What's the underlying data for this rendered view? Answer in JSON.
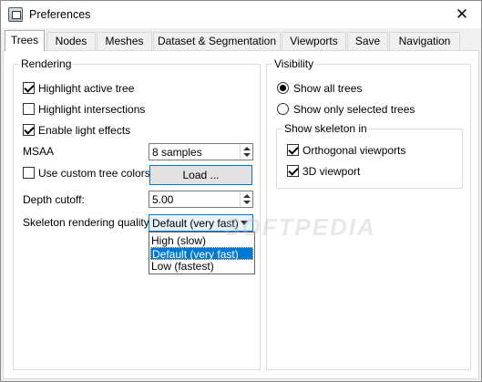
{
  "window": {
    "title": "Preferences",
    "close_glyph": "✕"
  },
  "tabs": [
    {
      "label": "Trees",
      "active": true
    },
    {
      "label": "Nodes"
    },
    {
      "label": "Meshes"
    },
    {
      "label": "Dataset & Segmentation"
    },
    {
      "label": "Viewports"
    },
    {
      "label": "Save"
    },
    {
      "label": "Navigation"
    }
  ],
  "rendering": {
    "title": "Rendering",
    "highlight_active_tree": {
      "label": "Highlight active tree",
      "checked": true
    },
    "highlight_intersections": {
      "label": "Highlight intersections",
      "checked": false
    },
    "enable_light_effects": {
      "label": "Enable light effects",
      "checked": true
    },
    "msaa": {
      "label": "MSAA",
      "value": "8 samples"
    },
    "custom_tree_colors": {
      "label": "Use custom tree colors",
      "checked": false
    },
    "load_button": "Load ...",
    "depth_cutoff": {
      "label": "Depth cutoff:",
      "value": "5.00"
    },
    "skeleton_quality": {
      "label": "Skeleton rendering quality:",
      "value": "Default (very fast)",
      "options": [
        "High (slow)",
        "Default (very fast)",
        "Low (fastest)"
      ],
      "selected_index": 1
    }
  },
  "visibility": {
    "title": "Visibility",
    "show_all_trees": {
      "label": "Show all trees",
      "checked": true
    },
    "show_selected_trees": {
      "label": "Show only selected trees",
      "checked": false
    },
    "show_skeleton_in": {
      "title": "Show skeleton in",
      "orthogonal": {
        "label": "Orthogonal viewports",
        "checked": true
      },
      "viewport_3d": {
        "label": "3D viewport",
        "checked": true
      }
    }
  },
  "watermark": "SOFTPEDIA"
}
